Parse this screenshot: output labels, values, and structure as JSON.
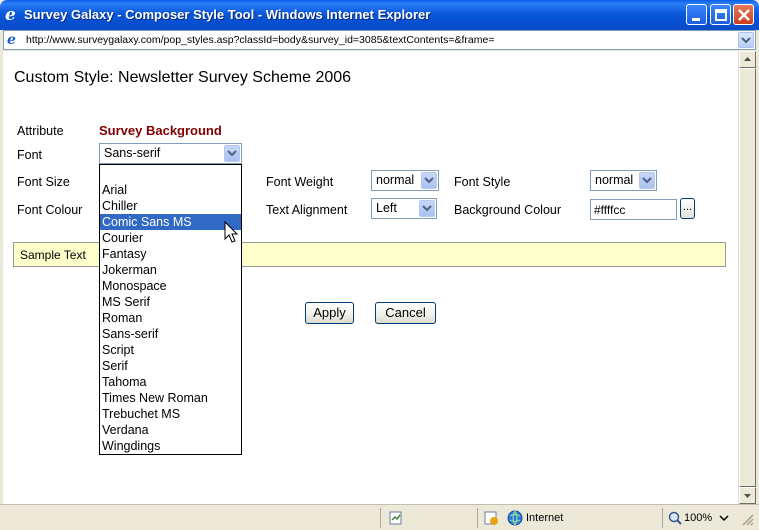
{
  "window": {
    "title": "Survey Galaxy - Composer Style Tool - Windows Internet Explorer",
    "url": "http://www.surveygalaxy.com/pop_styles.asp?classId=body&survey_id=3085&textContents=&frame="
  },
  "page": {
    "title": "Custom Style: Newsletter Survey Scheme 2006"
  },
  "form": {
    "attribute_label": "Attribute",
    "attribute_value": "Survey Background",
    "font_label": "Font",
    "font_value": "Sans-serif",
    "font_size_label": "Font Size",
    "font_colour_label": "Font Colour",
    "font_weight_label": "Font Weight",
    "font_weight_value": "normal",
    "text_alignment_label": "Text Alignment",
    "text_alignment_value": "Left",
    "font_style_label": "Font Style",
    "font_style_value": "normal",
    "background_colour_label": "Background Colour",
    "background_colour_value": "#ffffcc",
    "color_picker_label": "...",
    "sample_text": "Sample Text",
    "apply_label": "Apply",
    "cancel_label": "Cancel"
  },
  "font_dropdown": {
    "options": [
      "Arial",
      "Chiller",
      "Comic Sans MS",
      "Courier",
      "Fantasy",
      "Jokerman",
      "Monospace",
      "MS Serif",
      "Roman",
      "Sans-serif",
      "Script",
      "Serif",
      "Tahoma",
      "Times New Roman",
      "Trebuchet MS",
      "Verdana",
      "Wingdings"
    ],
    "highlighted": "Comic Sans MS"
  },
  "statusbar": {
    "zone": "Internet",
    "zoom": "100%"
  },
  "colors": {
    "titlebar": "#0a58dc",
    "attribute_value": "#800000",
    "selection": "#316ac5",
    "sample_background": "#ffffcc"
  }
}
